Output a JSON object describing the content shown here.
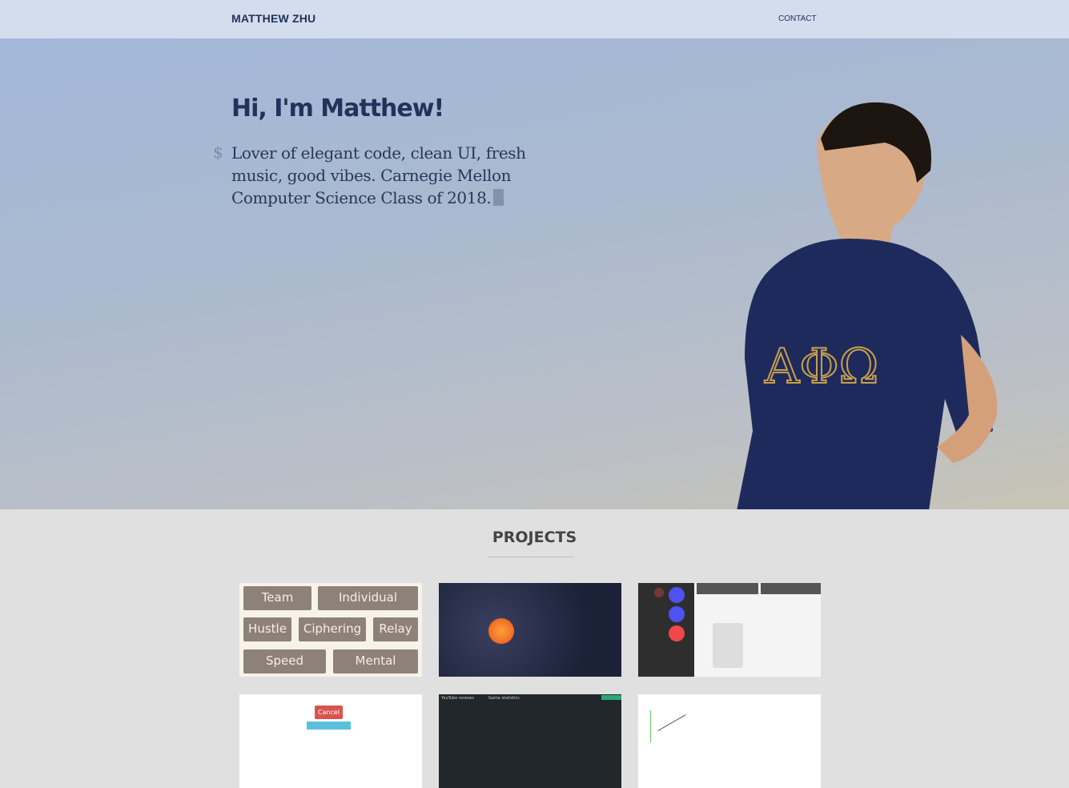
{
  "nav": {
    "brand": "MATTHEW ZHU",
    "contact": "CONTACT"
  },
  "hero": {
    "heading": "Hi, I'm Matthew!",
    "prompt": "$",
    "tagline": "Lover of elegant code, clean UI, fresh music, good vibes. Carnegie Mellon Computer Science Class of 2018."
  },
  "projects": {
    "title": "PROJECTS",
    "thumb1": {
      "buttons": [
        "Team",
        "Individual",
        "Hustle",
        "Ciphering",
        "Relay",
        "Speed",
        "Mental"
      ]
    },
    "thumb4": {
      "button": "Cancel"
    },
    "thumb5": {
      "left_title": "YouTube reviews",
      "right_title": "Game statistics"
    }
  }
}
